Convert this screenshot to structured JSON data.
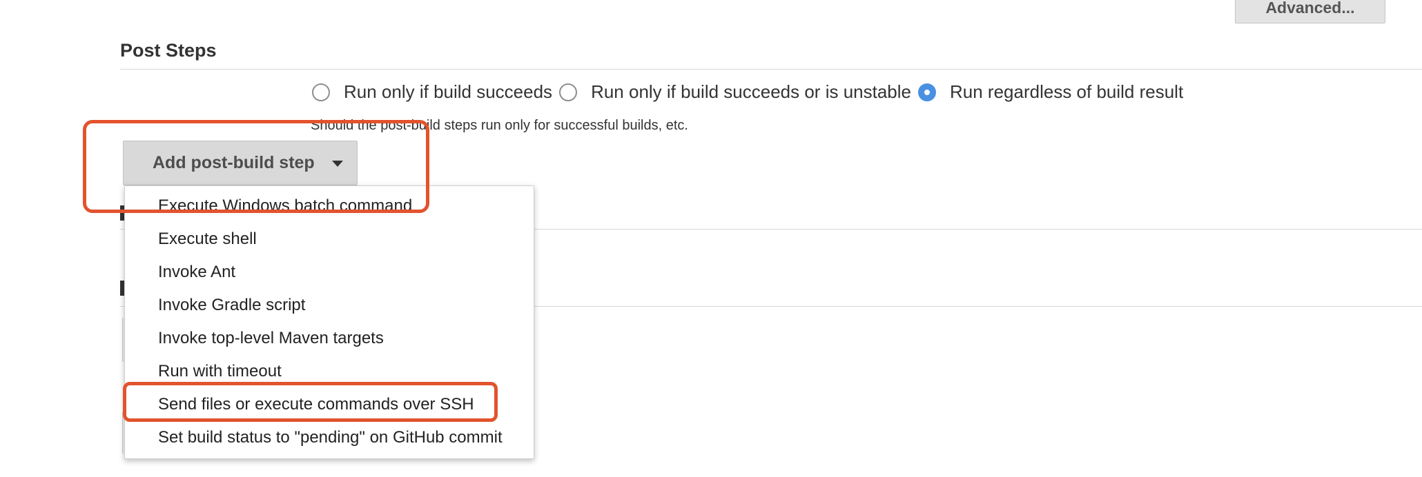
{
  "advanced_button": {
    "label": "Advanced..."
  },
  "post_steps": {
    "title": "Post Steps",
    "radio_options": [
      {
        "label": "Run only if build succeeds",
        "checked": false
      },
      {
        "label": "Run only if build succeeds or is unstable",
        "checked": false
      },
      {
        "label": "Run regardless of build result",
        "checked": true
      }
    ],
    "help_text": "Should the post-build steps run only for successful builds, etc.",
    "add_button": {
      "label": "Add post-build step",
      "icon": "caret-down-icon"
    }
  },
  "dropdown_menu": {
    "items": [
      "Execute Windows batch command",
      "Execute shell",
      "Invoke Ant",
      "Invoke Gradle script",
      "Invoke top-level Maven targets",
      "Run with timeout",
      "Send files or execute commands over SSH",
      "Set build status to \"pending\" on GitHub commit"
    ]
  },
  "colors": {
    "annotation": "#e2532e",
    "radio_selected": "#4a90e2"
  }
}
